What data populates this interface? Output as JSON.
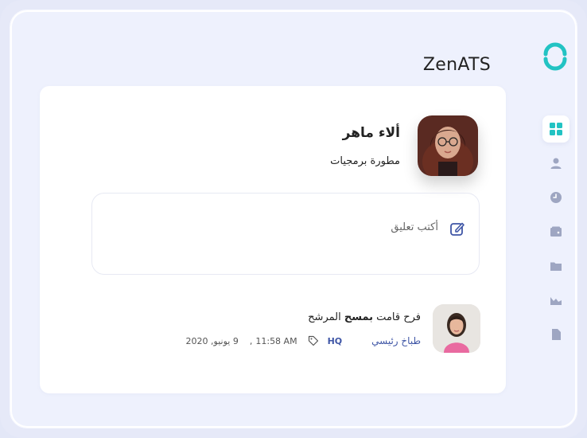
{
  "app": {
    "title": "ZenATS"
  },
  "sidebar": {
    "items": [
      {
        "icon": "dashboard-icon",
        "active": true
      },
      {
        "icon": "user-icon",
        "active": false
      },
      {
        "icon": "clock-icon",
        "active": false
      },
      {
        "icon": "wallet-icon",
        "active": false
      },
      {
        "icon": "folder-icon",
        "active": false
      },
      {
        "icon": "chart-icon",
        "active": false
      },
      {
        "icon": "document-icon",
        "active": false
      }
    ]
  },
  "profile": {
    "name": "ألاء ماهر",
    "role": "مطورة برمجيات"
  },
  "comment": {
    "placeholder": "أكتب تعليق"
  },
  "activity": {
    "actor": "فرح",
    "verb": " قامت ",
    "action": "بمسح",
    "object": " المرشح",
    "author": "طباخ رئيسي",
    "location": "HQ",
    "time": "11:58 AM",
    "separator": ",",
    "date": "9 يونيو, 2020"
  },
  "colors": {
    "accent": "#3f56a6",
    "brand_teal": "#22c3c3",
    "icon_gray": "#9ea6c2",
    "background": "#eef1fd"
  }
}
